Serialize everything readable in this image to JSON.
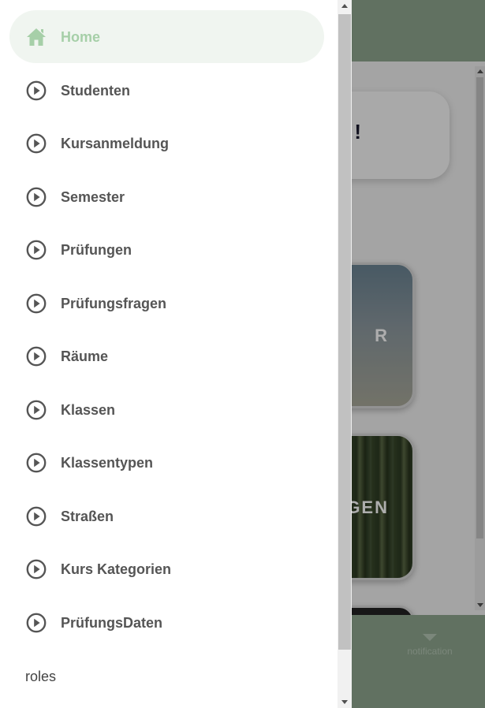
{
  "colors": {
    "active_text": "#a6cfa8",
    "active_bg": "#f0f5f0",
    "item_text": "#555555",
    "header_green": "#8fa78f"
  },
  "background": {
    "welcome_fragment": "!",
    "tile1_fragment": "R",
    "tile2_fragment": "GEN",
    "notification_label": "notification"
  },
  "drawer": {
    "items": [
      {
        "label": "Home",
        "icon": "home-icon",
        "active": true
      },
      {
        "label": "Studenten",
        "icon": "play-circle-icon"
      },
      {
        "label": "Kursanmeldung",
        "icon": "play-circle-icon"
      },
      {
        "label": "Semester",
        "icon": "play-circle-icon"
      },
      {
        "label": "Prüfungen",
        "icon": "play-circle-icon"
      },
      {
        "label": "Prüfungsfragen",
        "icon": "play-circle-icon"
      },
      {
        "label": "Räume",
        "icon": "play-circle-icon"
      },
      {
        "label": "Klassen",
        "icon": "play-circle-icon"
      },
      {
        "label": "Klassentypen",
        "icon": "play-circle-icon"
      },
      {
        "label": "Straßen",
        "icon": "play-circle-icon"
      },
      {
        "label": "Kurs Kategorien",
        "icon": "play-circle-icon"
      },
      {
        "label": "PrüfungsDaten",
        "icon": "play-circle-icon"
      }
    ],
    "section_label": "roles"
  }
}
